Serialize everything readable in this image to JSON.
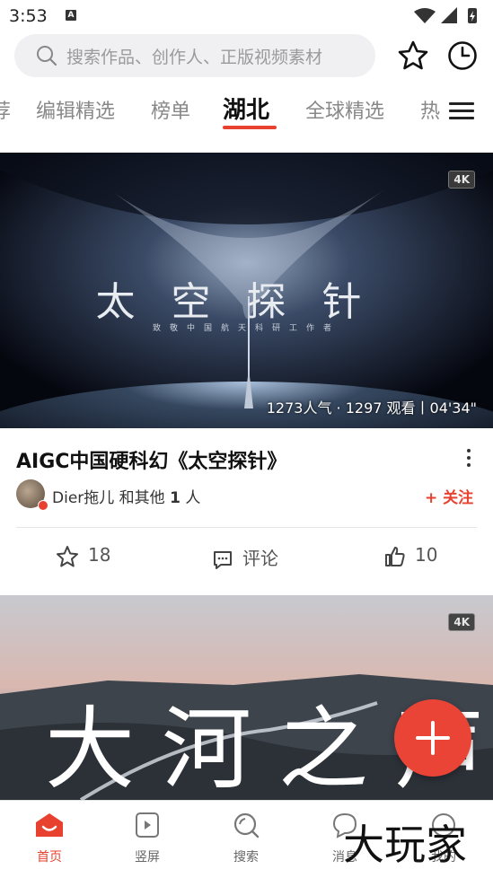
{
  "status_bar": {
    "time": "3:53",
    "notification": "A"
  },
  "search": {
    "placeholder": "搜索作品、创作人、正版视频素材"
  },
  "tabs": [
    {
      "label": "荐",
      "active": false
    },
    {
      "label": "编辑精选",
      "active": false
    },
    {
      "label": "榜单",
      "active": false
    },
    {
      "label": "湖北",
      "active": true
    },
    {
      "label": "全球精选",
      "active": false
    },
    {
      "label": "热",
      "active": false
    }
  ],
  "feed": [
    {
      "badge": "4K",
      "overlay_title": "太空探针",
      "overlay_subtitle": "致敬中国航天科研工作者",
      "stats": "1273人气 · 1297 观看丨04'34\"",
      "title": "AIGC中国硬科幻《太空探针》",
      "author": "Dier拖儿",
      "author_suffix_pre": " 和其他 ",
      "author_count": "1",
      "author_suffix_post": " 人",
      "follow_label": "+ 关注",
      "favorites": "18",
      "comment_label": "评论",
      "likes": "10"
    },
    {
      "badge": "4K",
      "overlay_title": "大河之声"
    }
  ],
  "bottom_nav": [
    {
      "label": "首页",
      "active": true,
      "icon": "home-icon"
    },
    {
      "label": "竖屏",
      "active": false,
      "icon": "vertical-video-icon"
    },
    {
      "label": "搜索",
      "active": false,
      "icon": "search-icon"
    },
    {
      "label": "消息",
      "active": false,
      "icon": "message-icon"
    },
    {
      "label": "我的",
      "active": false,
      "icon": "profile-icon"
    }
  ],
  "watermark": "大玩家",
  "colors": {
    "accent": "#e8412f",
    "fab": "#ea4436"
  }
}
